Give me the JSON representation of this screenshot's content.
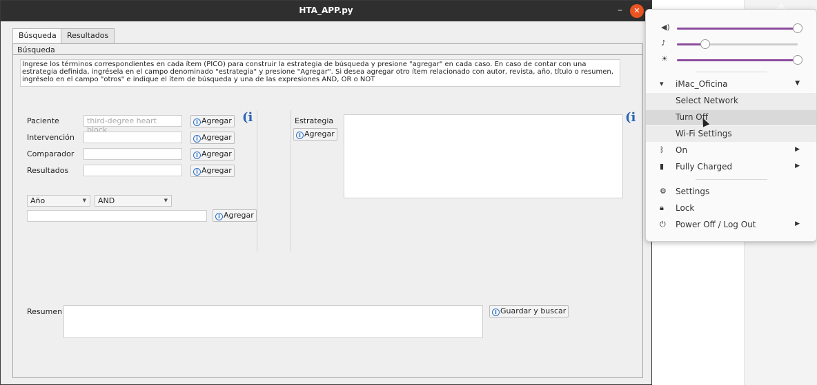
{
  "window": {
    "title": "HTA_APP.py",
    "minimize_glyph": "–",
    "close_glyph": "✕"
  },
  "tabs": [
    "Búsqueda",
    "Resultados"
  ],
  "group_title": "Búsqueda",
  "instructions": "Ingrese los términos correspondientes en cada ítem (PICO) para construir la estrategia de búsqueda y presione \"agregar\" en cada caso. En caso de contar con una estrategia definida, ingrésela en el campo denominado \"estrategia\" y presione \"Agregar\". Si desea agregar otro ítem relacionado con autor, revista, año, título o resumen, ingréselo en el campo \"otros\" e indique el ítem de búsqueda y una de las expresiones AND, OR o NOT",
  "pico": [
    {
      "label": "Paciente",
      "value": "third-degree heart block",
      "button": "Agregar"
    },
    {
      "label": "Intervención",
      "value": "",
      "button": "Agregar"
    },
    {
      "label": "Comparador",
      "value": "",
      "button": "Agregar"
    },
    {
      "label": "Resultados",
      "value": "",
      "button": "Agregar"
    }
  ],
  "other": {
    "field_select": "Año",
    "operator_select": "AND",
    "value": "",
    "button": "Agregar"
  },
  "strategy": {
    "label": "Estrategia",
    "button": "Agregar",
    "value": ""
  },
  "summary": {
    "label": "Resumen",
    "value": "",
    "button": "Guardar y buscar"
  },
  "info_glyph": "i",
  "system_menu": {
    "sliders": [
      {
        "icon": "speaker-icon",
        "glyph": "◀)",
        "level": 1.0
      },
      {
        "icon": "microphone-icon",
        "glyph": "🎙",
        "level": 0.25
      },
      {
        "icon": "brightness-icon",
        "glyph": "☀",
        "level": 1.0
      }
    ],
    "network": {
      "name": "iMac_Oficina",
      "items": [
        "Select Network",
        "Turn Off",
        "Wi-Fi Settings"
      ]
    },
    "bluetooth": "On",
    "battery": "Fully Charged",
    "settings": "Settings",
    "lock": "Lock",
    "power": "Power Off / Log Out"
  },
  "colors": {
    "accent": "#8b4a9c",
    "close": "#e95420",
    "info": "#2a62b8"
  }
}
